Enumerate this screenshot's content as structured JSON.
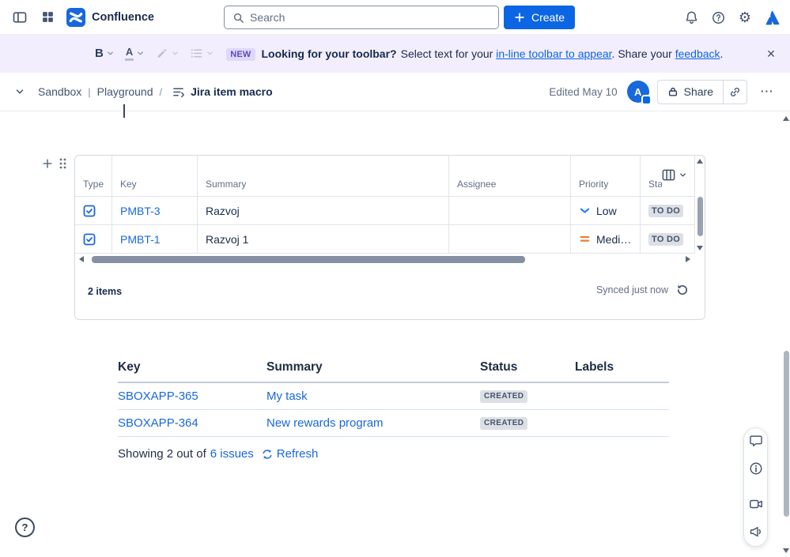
{
  "colors": {
    "brand_blue": "#1868DB",
    "link_blue": "#0C66E4",
    "banner_bg": "#F3EEFD",
    "new_badge_bg": "#DFD8FD",
    "new_badge_text": "#5E4DB2",
    "status_badge_bg": "#DCDFE4",
    "status_badge_text": "#44546F",
    "priority_low": "#1D7AFC",
    "priority_medium": "#E97F33"
  },
  "icons": {
    "gear": "⚙",
    "more": "⋯",
    "close": "✕",
    "help": "?"
  },
  "topbar": {
    "app_name": "Confluence",
    "search_placeholder": "Search",
    "create_label": "Create"
  },
  "banner": {
    "bold_button": "B",
    "text_color_button": "A",
    "new_badge": "NEW",
    "headline": "Looking for your toolbar?",
    "body_1": "Select text for your ",
    "link_inline_toolbar": "in-line toolbar to appear",
    "body_2": ". Share your ",
    "link_feedback": "feedback",
    "body_3": "."
  },
  "breadcrumb": {
    "space": "Sandbox",
    "divider": "|",
    "section": "Playground",
    "slash": "/",
    "page_title": "Jira item macro",
    "edited": "Edited May 10",
    "avatar_initial": "A",
    "share_label": "Share"
  },
  "jira_macro": {
    "columns": [
      "Type",
      "Key",
      "Summary",
      "Assignee",
      "Priority",
      "Status"
    ],
    "rows": [
      {
        "key": "PMBT-3",
        "summary": "Razvoj",
        "assignee": "",
        "priority": "Low",
        "status": "TO DO"
      },
      {
        "key": "PMBT-1",
        "summary": "Razvoj 1",
        "assignee": "",
        "priority": "Medium",
        "status": "TO DO"
      }
    ],
    "items_count": "2 items",
    "synced_label": "Synced just now"
  },
  "issues_table": {
    "headers": [
      "Key",
      "Summary",
      "Status",
      "Labels"
    ],
    "rows": [
      {
        "key": "SBOXAPP-365",
        "summary": "My task",
        "status": "CREATED",
        "labels": ""
      },
      {
        "key": "SBOXAPP-364",
        "summary": "New rewards program",
        "status": "CREATED",
        "labels": ""
      }
    ],
    "footer_prefix": "Showing 2 out of",
    "issues_link": "6 issues",
    "refresh_label": "Refresh"
  }
}
